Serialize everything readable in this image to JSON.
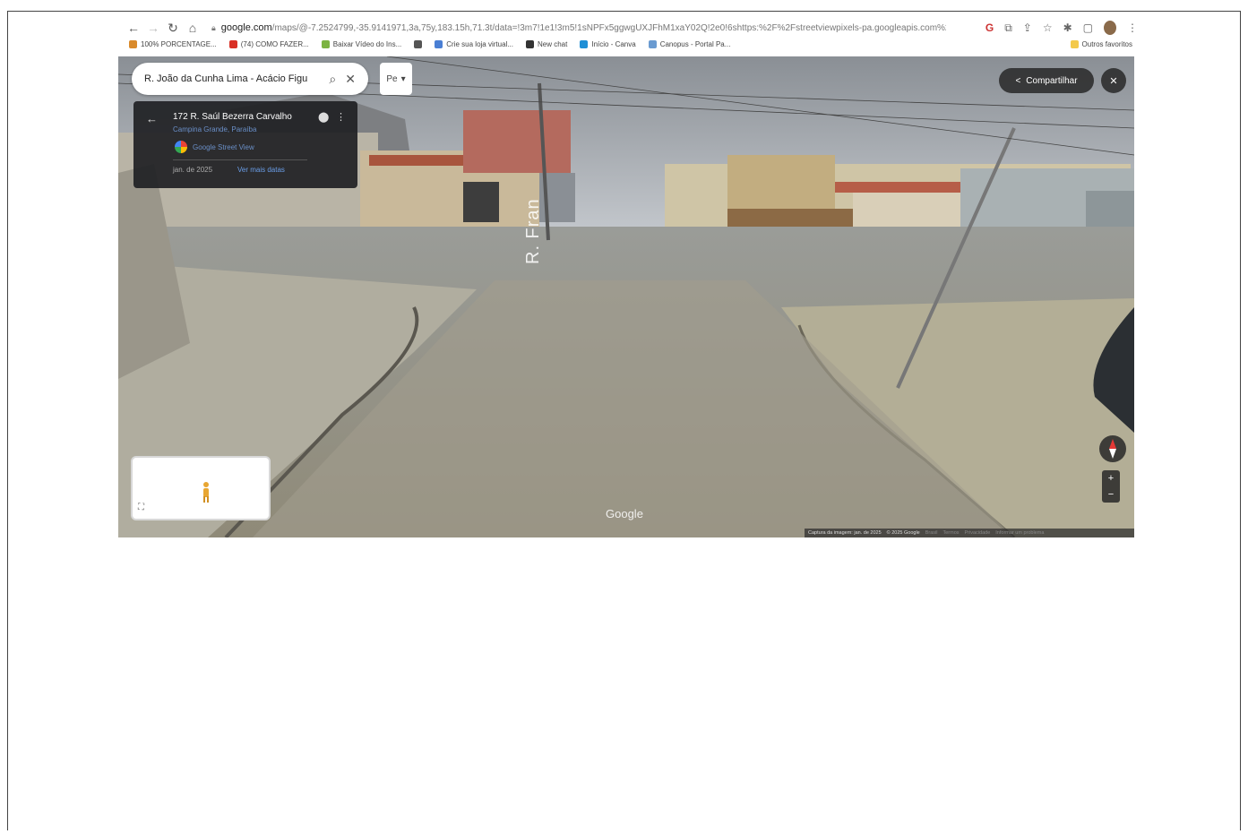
{
  "browser": {
    "url_domain": "google.com",
    "url_rest": "/maps/@-7.2524799,-35.9141971,3a,75y,183.15h,71.3t/data=!3m7!1e1!3m5!1sNPFx5ggwgUXJFhM1xaY02Q!2e0!6shttps:%2F%2Fstreetviewpixels-pa.googleapis.com%2Fv1%...",
    "bookmarks": [
      {
        "label": "100% PORCENTAGE...",
        "color": "#d98a2b"
      },
      {
        "label": "(74) COMO FAZER...",
        "color": "#d93025"
      },
      {
        "label": "Baixar Vídeo do Ins...",
        "color": "#7cb342"
      },
      {
        "label": "",
        "color": "#555555"
      },
      {
        "label": "Crie sua loja virtual...",
        "color": "#4a7fd4"
      },
      {
        "label": "New chat",
        "color": "#333333"
      },
      {
        "label": "Início - Canva",
        "color": "#1f8fd6"
      },
      {
        "label": "Canopus - Portal Pa...",
        "color": "#6a9bd1"
      }
    ],
    "other_bookmarks": "Outros favoritos"
  },
  "streetview": {
    "search_query": "R. João da Cunha Lima - Acácio Figu",
    "layer_label": "Pe",
    "info": {
      "address": "172 R. Saúl Bezerra Carvalho",
      "city": "Campina Grande, Paraíba",
      "source": "Google Street View",
      "date": "jan. de 2025",
      "more_dates": "Ver mais datas"
    },
    "share_label": "Compartilhar",
    "street_label": "R. Fran",
    "logo": "Google",
    "footer": {
      "capture": "Captura da imagem: jan. de 2025",
      "copyright": "© 2025 Google",
      "links": [
        "Brasil",
        "Termos",
        "Privacidade",
        "Informar um problema"
      ]
    }
  }
}
